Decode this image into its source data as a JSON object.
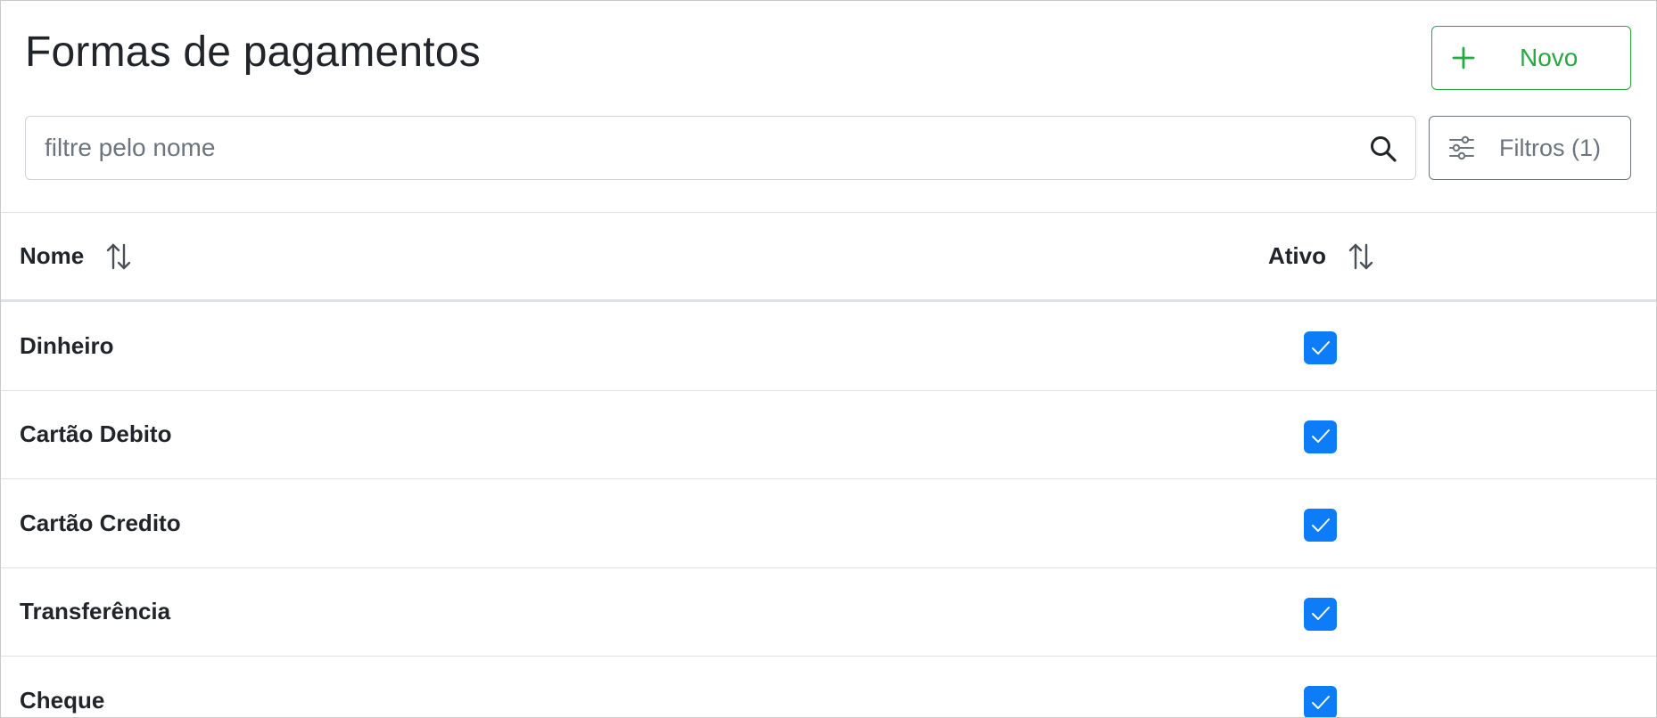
{
  "page": {
    "title": "Formas de pagamentos"
  },
  "toolbar": {
    "new_label": "Novo",
    "new_icon": "plus-icon",
    "filter_label": "Filtros (1)",
    "filter_icon": "sliders-icon"
  },
  "search": {
    "placeholder": "filtre pelo nome",
    "value": "",
    "icon": "search-icon"
  },
  "table": {
    "columns": [
      {
        "label": "Nome",
        "sort_icon": "sort-arrows-icon"
      },
      {
        "label": "Ativo",
        "sort_icon": "sort-arrows-icon"
      }
    ],
    "rows": [
      {
        "name": "Dinheiro",
        "active": true
      },
      {
        "name": "Cartão Debito",
        "active": true
      },
      {
        "name": "Cartão Credito",
        "active": true
      },
      {
        "name": "Transferência",
        "active": true
      },
      {
        "name": "Cheque",
        "active": true
      }
    ]
  },
  "colors": {
    "success": "#28a745",
    "secondary": "#6c757d",
    "checkbox": "#0d7cf8",
    "border": "#dee2e6"
  }
}
